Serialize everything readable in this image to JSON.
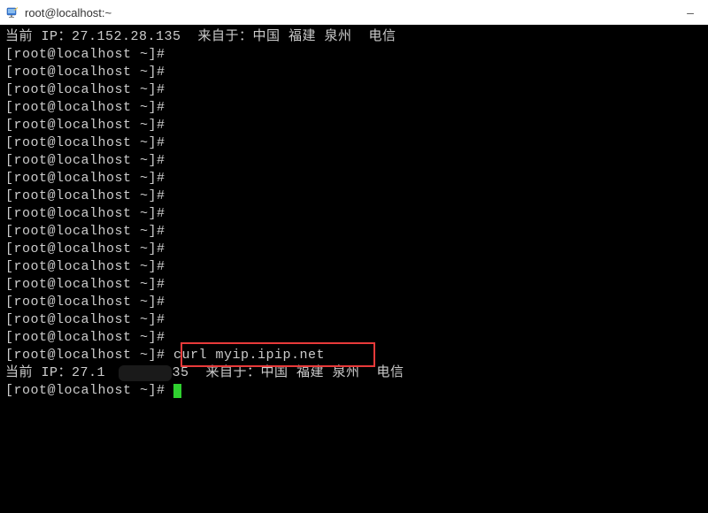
{
  "titlebar": {
    "icon_name": "terminal-icon",
    "title": "root@localhost:~",
    "minimize": "–"
  },
  "terminal": {
    "info_line_1": "当前 IP：27.152.28.135  来自于：中国 福建 泉州  电信",
    "info_line_2_pre": "当前 IP：27.1",
    "info_line_2_post": "135  来自于：中国 福建 泉州  电信",
    "prompt": "[root@localhost ~]#",
    "prompt_with_space": "[root@localhost ~]# ",
    "command": "curl myip.ipip.net",
    "empty_prompts_count": 17
  },
  "colors": {
    "highlight_border": "#e83a3a",
    "cursor": "#2fd02f",
    "terminal_bg": "#000000",
    "terminal_fg": "#cccccc"
  }
}
